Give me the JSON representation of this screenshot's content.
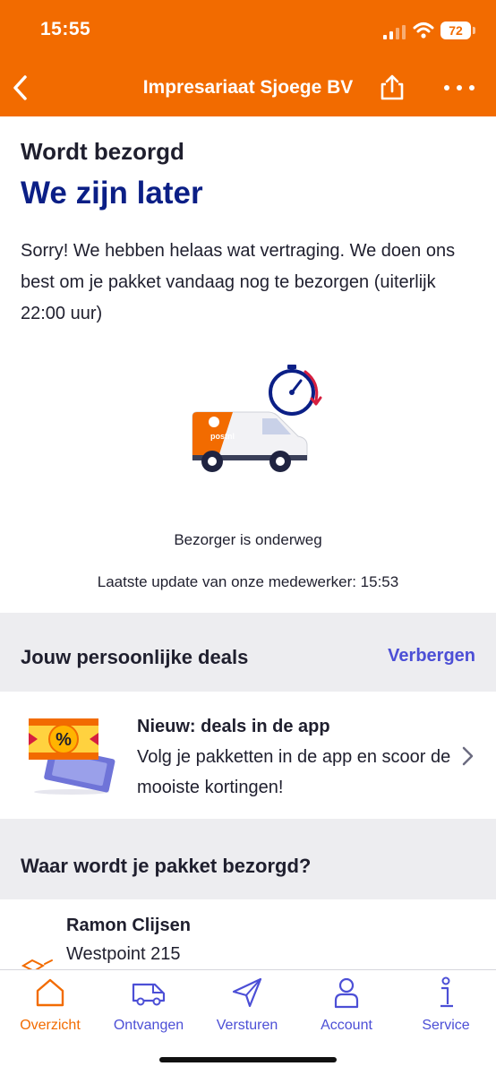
{
  "status_bar": {
    "time": "15:55",
    "battery": "72"
  },
  "nav": {
    "title": "Impresariaat Sjoege BV",
    "back_icon": "chevron-left-icon",
    "share_icon": "share-icon",
    "more_icon": "more-icon"
  },
  "status": {
    "label": "Wordt bezorgd",
    "title": "We zijn later",
    "message": "Sorry! We hebben helaas wat vertraging. We doen ons best om je pakket vandaag nog te bezorgen (uiterlijk 22:00 uur)",
    "illustration_text": "postnl",
    "sub": "Bezorger is onderweg",
    "update": "Laatste update van onze medewerker: 15:53"
  },
  "deals": {
    "title": "Jouw persoonlijke deals",
    "hide_label": "Verbergen",
    "card": {
      "title": "Nieuw: deals in de app",
      "text": "Volg je pakketten in de app en scoor de mooiste kortingen!",
      "badge": "%"
    }
  },
  "address": {
    "title": "Waar wordt je pakket bezorgd?",
    "name": "Ramon Clijsen",
    "street": "Westpoint 215"
  },
  "tabs": [
    {
      "label": "Overzicht",
      "icon": "home-icon",
      "active": true
    },
    {
      "label": "Ontvangen",
      "icon": "van-icon",
      "active": false
    },
    {
      "label": "Versturen",
      "icon": "send-icon",
      "active": false
    },
    {
      "label": "Account",
      "icon": "user-icon",
      "active": false
    },
    {
      "label": "Service",
      "icon": "info-icon",
      "active": false
    }
  ],
  "colors": {
    "brand_orange": "#f26b00",
    "navy": "#0b1f86",
    "accent_purple": "#4c4fd6"
  }
}
